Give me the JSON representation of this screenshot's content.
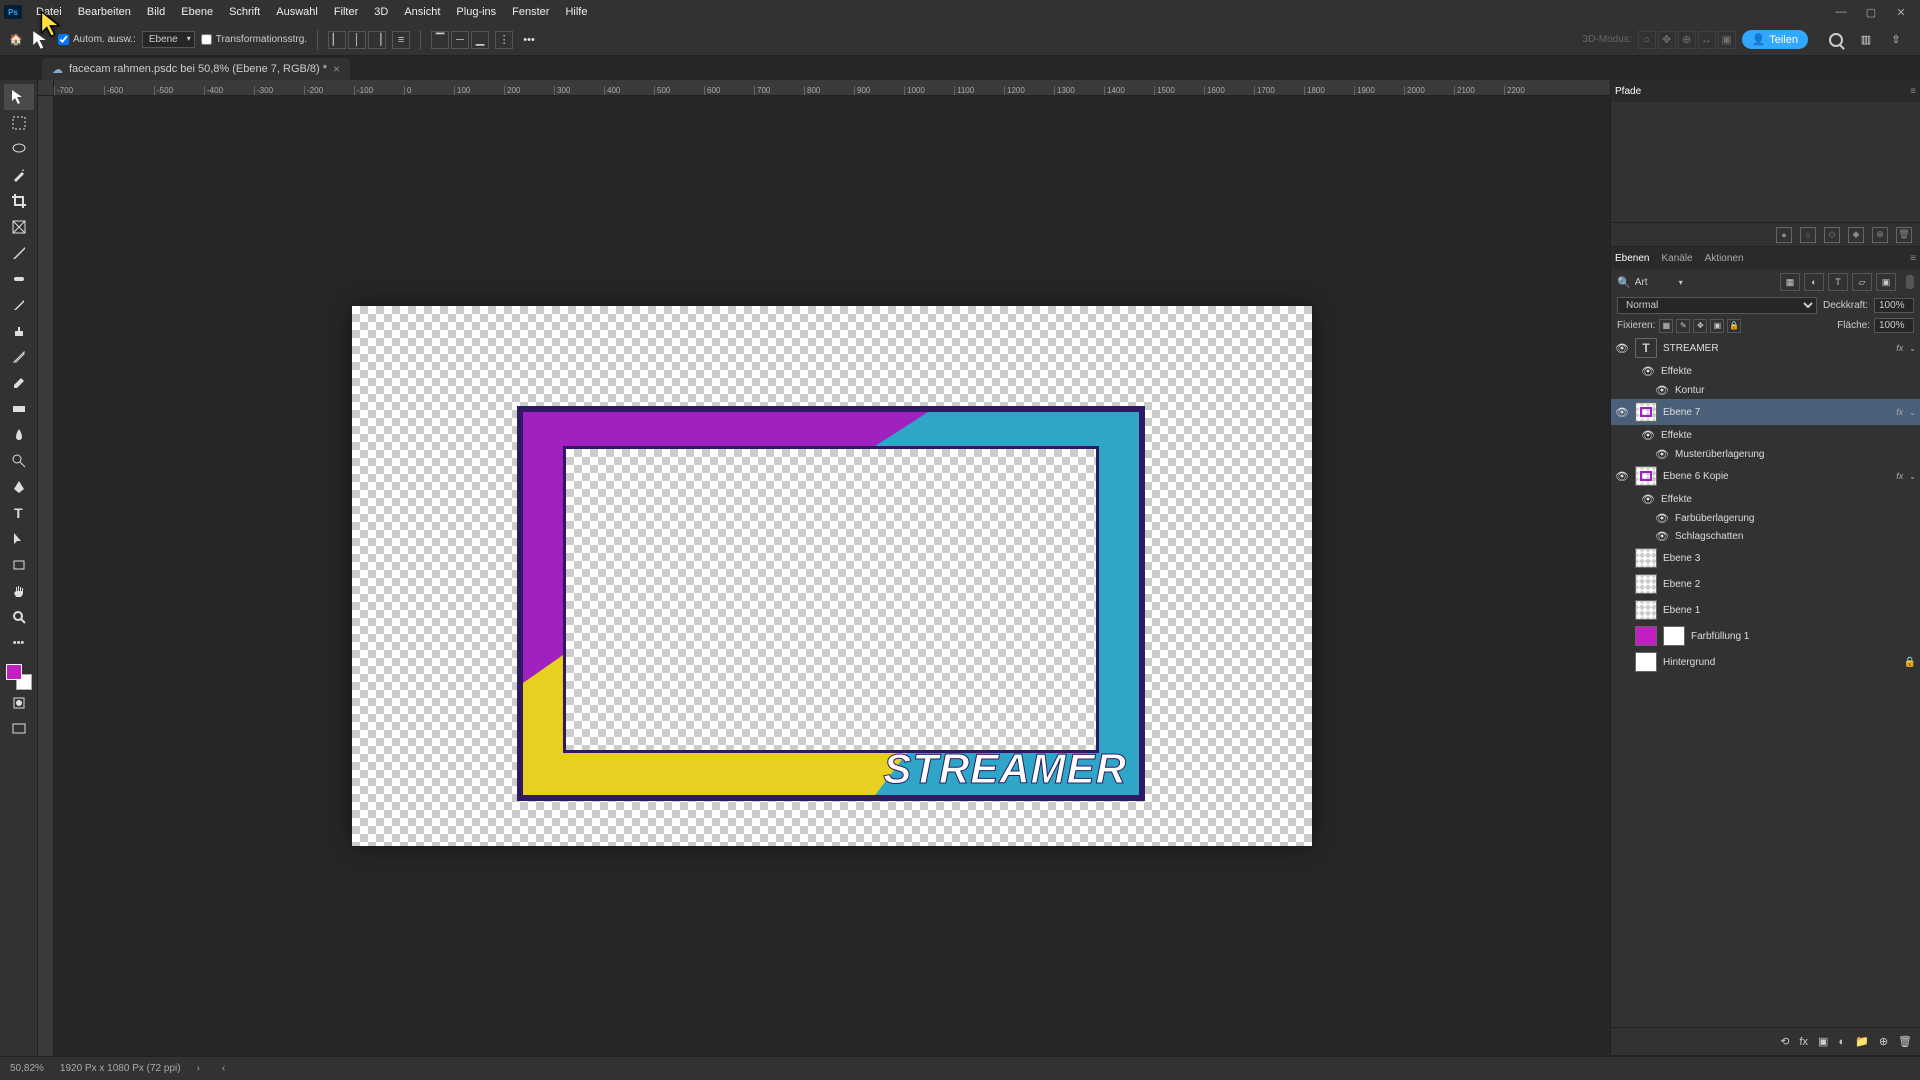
{
  "menu": [
    "Datei",
    "Bearbeiten",
    "Bild",
    "Ebene",
    "Schrift",
    "Auswahl",
    "Filter",
    "3D",
    "Ansicht",
    "Plug-ins",
    "Fenster",
    "Hilfe"
  ],
  "options": {
    "auto_select": "Autom. ausw.:",
    "auto_select_target": "Ebene",
    "transform_controls": "Transformationsstrg.",
    "mode_3d": "3D-Modus:"
  },
  "share_button": "Teilen",
  "document": {
    "tab_title": "facecam rahmen.psdc bei 50,8% (Ebene 7, RGB/8) *"
  },
  "ruler_marks": [
    "-700",
    "-600",
    "-500",
    "-400",
    "-300",
    "-200",
    "-100",
    "0",
    "100",
    "200",
    "300",
    "400",
    "500",
    "600",
    "700",
    "800",
    "900",
    "1000",
    "1100",
    "1200",
    "1300",
    "1400",
    "1500",
    "1600",
    "1700",
    "1800",
    "1900",
    "2000",
    "2100",
    "2200"
  ],
  "artwork": {
    "streamer_text": "STREAMER"
  },
  "colors": {
    "foreground": "#c020c0",
    "background": "#ffffff"
  },
  "panels": {
    "pfade_tab": "Pfade",
    "layers_tabs": [
      "Ebenen",
      "Kanäle",
      "Aktionen"
    ],
    "filter_label": "Art",
    "blend_mode": "Normal",
    "opacity_label": "Deckkraft:",
    "opacity_value": "100%",
    "lock_label": "Fixieren:",
    "fill_label": "Fläche:",
    "fill_value": "100%"
  },
  "layers": [
    {
      "name": "STREAMER",
      "type": "text",
      "visible": true,
      "fx": true
    },
    {
      "name": "Effekte",
      "type": "fx-hdr",
      "indent": 1
    },
    {
      "name": "Kontur",
      "type": "fx-item",
      "indent": 2
    },
    {
      "name": "Ebene 7",
      "type": "raster",
      "visible": true,
      "fx": true,
      "selected": true,
      "thumbclass": "checker color"
    },
    {
      "name": "Effekte",
      "type": "fx-hdr",
      "indent": 1
    },
    {
      "name": "Musterüberlagerung",
      "type": "fx-item",
      "indent": 2
    },
    {
      "name": "Ebene 6 Kopie",
      "type": "raster",
      "visible": true,
      "fx": true,
      "thumbclass": "checker color"
    },
    {
      "name": "Effekte",
      "type": "fx-hdr",
      "indent": 1
    },
    {
      "name": "Farbüberlagerung",
      "type": "fx-item",
      "indent": 2
    },
    {
      "name": "Schlagschatten",
      "type": "fx-item",
      "indent": 2
    },
    {
      "name": "Ebene 3",
      "type": "raster",
      "visible": false,
      "thumbclass": "checker"
    },
    {
      "name": "Ebene 2",
      "type": "raster",
      "visible": false,
      "thumbclass": "checker"
    },
    {
      "name": "Ebene 1",
      "type": "raster",
      "visible": false,
      "thumbclass": "checker"
    },
    {
      "name": "Farbfüllung 1",
      "type": "fill",
      "visible": false,
      "thumbstyle": "#c020c0"
    },
    {
      "name": "Hintergrund",
      "type": "bg",
      "visible": false,
      "locked": true
    }
  ],
  "status": {
    "zoom": "50,82%",
    "doc_info": "1920 Px x 1080 Px (72 ppi)"
  }
}
